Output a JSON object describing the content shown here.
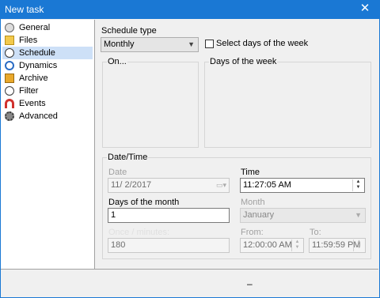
{
  "window": {
    "title": "New task",
    "close_glyph": "✕"
  },
  "nav": {
    "items": [
      {
        "label": "General",
        "icon": "general-icon"
      },
      {
        "label": "Files",
        "icon": "files-icon"
      },
      {
        "label": "Schedule",
        "icon": "schedule-icon",
        "selected": true
      },
      {
        "label": "Dynamics",
        "icon": "dynamics-icon"
      },
      {
        "label": "Archive",
        "icon": "archive-icon"
      },
      {
        "label": "Filter",
        "icon": "filter-icon"
      },
      {
        "label": "Events",
        "icon": "events-icon"
      },
      {
        "label": "Advanced",
        "icon": "advanced-icon"
      }
    ]
  },
  "schedule": {
    "type_label": "Schedule type",
    "type_value": "Monthly",
    "days_checkbox_label": "Select days of the week",
    "on_label": "On...",
    "days_of_week_label": "Days of the week"
  },
  "datetime": {
    "group_label": "Date/Time",
    "date_label": "Date",
    "date_value": "11/  2/2017",
    "time_label": "Time",
    "time_value": "11:27:05 AM",
    "days_of_month_label": "Days of the month",
    "days_of_month_value": "1",
    "month_label": "Month",
    "month_value": "January",
    "interval_label": "Once / minutes:",
    "interval_value": "180",
    "from_label": "From:",
    "from_value": "12:00:00 AM",
    "to_label": "To:",
    "to_value": "11:59:59 PM"
  },
  "footer": {
    "glyph": "–"
  },
  "colors": {
    "titlebar": "#1a78d4",
    "selection": "#cde0f7"
  }
}
